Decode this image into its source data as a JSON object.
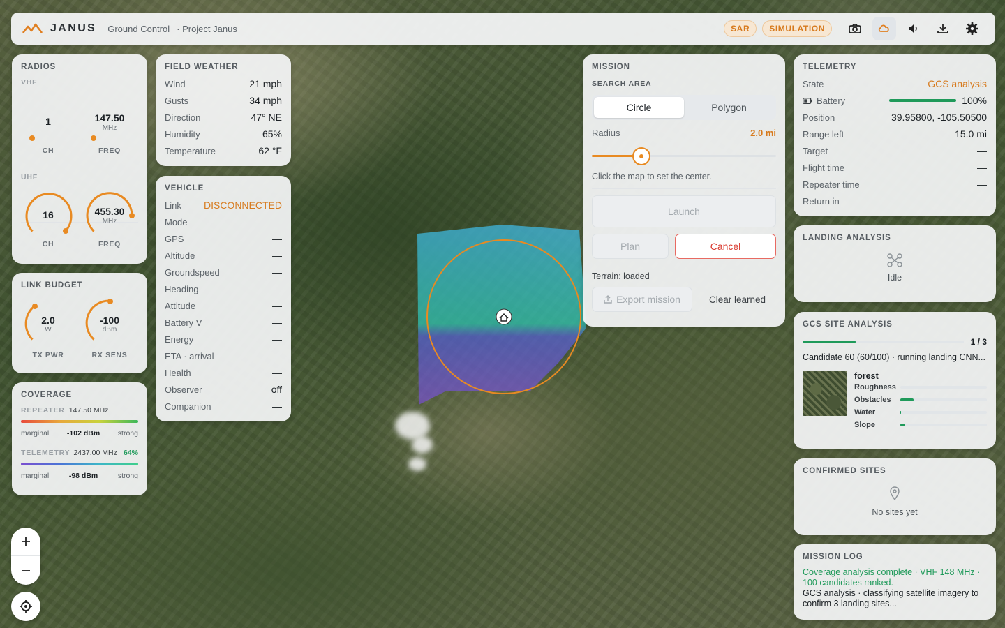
{
  "topbar": {
    "brand": "JANUS",
    "crumb1": "Ground Control",
    "crumb2": "· Project Janus",
    "badge_sar": "SAR",
    "badge_sim": "SIMULATION",
    "accent": "#e07f20"
  },
  "radios": {
    "title": "RADIOS",
    "vhf_label": "VHF",
    "uhf_label": "UHF",
    "vhf_ch": "1",
    "vhf_freq": "147.50",
    "uhf_ch": "16",
    "uhf_freq": "455.30",
    "unit_mhz": "MHz",
    "ch_label": "CH",
    "freq_label": "FREQ"
  },
  "link_budget": {
    "title": "LINK BUDGET",
    "tx_value": "2.0",
    "tx_unit": "W",
    "tx_label": "TX PWR",
    "rx_value": "-100",
    "rx_unit": "dBm",
    "rx_label": "RX SENS"
  },
  "coverage": {
    "title": "COVERAGE",
    "repeater_label": "REPEATER",
    "repeater_freq": "147.50 MHz",
    "repeater_marginal": "marginal",
    "repeater_dbm": "-102 dBm",
    "repeater_strong": "strong",
    "telemetry_label": "TELEMETRY",
    "telemetry_freq": "2437.00 MHz",
    "telemetry_pct": "64%",
    "telemetry_marginal": "marginal",
    "telemetry_dbm": "-98 dBm",
    "telemetry_strong": "strong"
  },
  "weather": {
    "title": "FIELD WEATHER",
    "rows": [
      {
        "k": "Wind",
        "v": "21 mph"
      },
      {
        "k": "Gusts",
        "v": "34 mph"
      },
      {
        "k": "Direction",
        "v": "47° NE"
      },
      {
        "k": "Humidity",
        "v": "65%"
      },
      {
        "k": "Temperature",
        "v": "62 °F"
      }
    ]
  },
  "vehicle": {
    "title": "VEHICLE",
    "link_label": "Link",
    "link_value": "DISCONNECTED",
    "rows": [
      {
        "k": "Mode",
        "v": "—"
      },
      {
        "k": "GPS",
        "v": "—"
      },
      {
        "k": "Altitude",
        "v": "—"
      },
      {
        "k": "Groundspeed",
        "v": "—"
      },
      {
        "k": "Heading",
        "v": "—"
      },
      {
        "k": "Attitude",
        "v": "—"
      },
      {
        "k": "Battery V",
        "v": "—"
      },
      {
        "k": "Energy",
        "v": "—"
      },
      {
        "k": "ETA · arrival",
        "v": "—"
      },
      {
        "k": "Health",
        "v": "—"
      },
      {
        "k": "Observer",
        "v": "off"
      },
      {
        "k": "Companion",
        "v": "—"
      }
    ]
  },
  "mission": {
    "title": "MISSION",
    "search_area": "SEARCH AREA",
    "tab_circle": "Circle",
    "tab_polygon": "Polygon",
    "radius_label": "Radius",
    "radius_value": "2.0 mi",
    "radius_fraction": 0.27,
    "hint": "Click the map to set the center.",
    "launch": "Launch",
    "plan": "Plan",
    "cancel": "Cancel",
    "terrain": "Terrain: loaded",
    "export": "Export mission",
    "clear": "Clear learned"
  },
  "telemetry": {
    "title": "TELEMETRY",
    "state_label": "State",
    "state_value": "GCS analysis",
    "battery_label": "Battery",
    "battery_value": "100%",
    "battery_fraction": 1.0,
    "rows": [
      {
        "k": "Position",
        "v": "39.95800, -105.50500"
      },
      {
        "k": "Range left",
        "v": "15.0 mi"
      },
      {
        "k": "Target",
        "v": "—"
      },
      {
        "k": "Flight time",
        "v": "—"
      },
      {
        "k": "Repeater time",
        "v": "—"
      },
      {
        "k": "Return in",
        "v": "—"
      }
    ]
  },
  "landing": {
    "title": "LANDING ANALYSIS",
    "status": "Idle"
  },
  "gcs_site": {
    "title": "GCS SITE ANALYSIS",
    "progress_text": "1 / 3",
    "progress_fraction": 0.33,
    "candidate": "Candidate 60 (60/100) · running landing CNN...",
    "terrain_class": "forest",
    "metrics": [
      {
        "k": "Roughness",
        "v": 0.0
      },
      {
        "k": "Obstacles",
        "v": 0.15
      },
      {
        "k": "Water",
        "v": 0.01
      },
      {
        "k": "Slope",
        "v": 0.06
      }
    ]
  },
  "confirmed": {
    "title": "CONFIRMED SITES",
    "empty": "No sites yet"
  },
  "log": {
    "title": "MISSION LOG",
    "line1": "Coverage analysis complete · VHF 148 MHz · 100 candidates ranked.",
    "line2": "GCS analysis · classifying satellite imagery to confirm 3 landing sites..."
  },
  "colors": {
    "accent_orange": "#e07f20",
    "success_green": "#1f9a5a",
    "danger_red": "#d9392e"
  }
}
